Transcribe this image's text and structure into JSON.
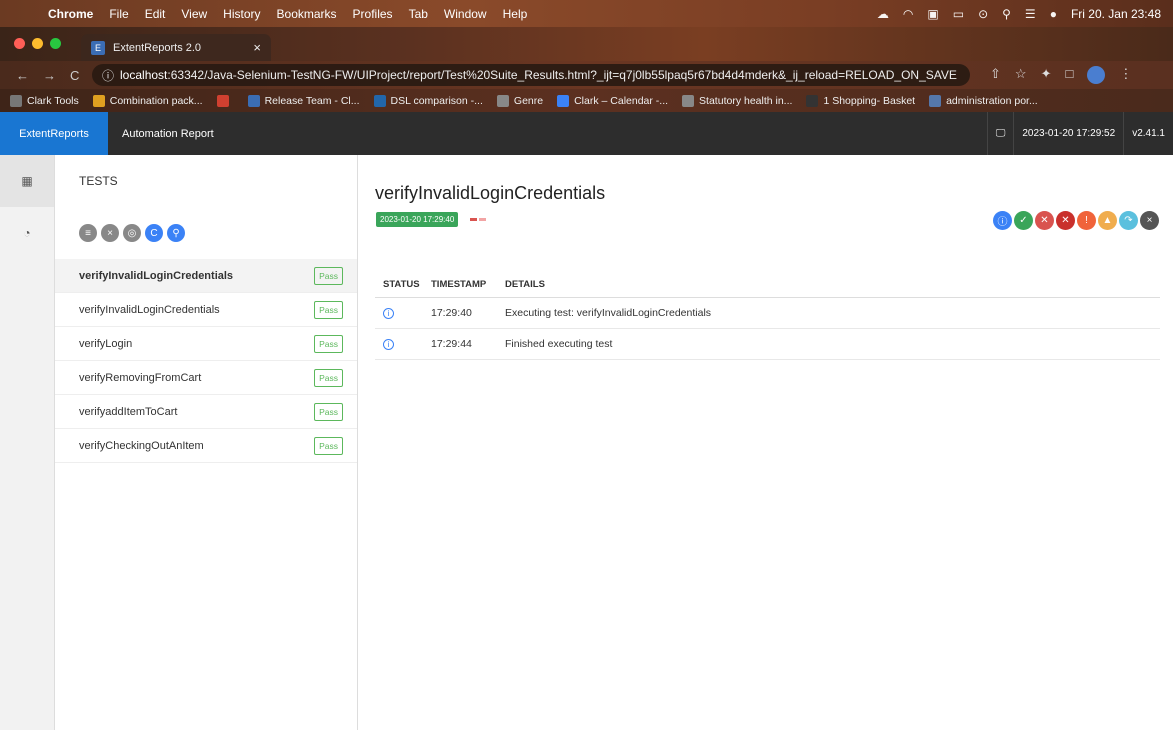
{
  "menubar": {
    "app": "Chrome",
    "items": [
      "File",
      "Edit",
      "View",
      "History",
      "Bookmarks",
      "Profiles",
      "Tab",
      "Window",
      "Help"
    ],
    "datetime": "Fri 20. Jan 23:48"
  },
  "browser": {
    "tab_title": "ExtentReports 2.0",
    "url_prefix": "localhost",
    "url_rest": ":63342/Java-Selenium-TestNG-FW/UIProject/report/Test%20Suite_Results.html?_ijt=q7j0lb55lpaq5r67bd4d4mderk&_ij_reload=RELOAD_ON_SAVE",
    "bookmarks": [
      {
        "label": "Clark Tools",
        "color": "#777777"
      },
      {
        "label": "Combination pack...",
        "color": "#e0a020"
      },
      {
        "label": "",
        "color": "#d04030"
      },
      {
        "label": "Release Team - Cl...",
        "color": "#3b6db4"
      },
      {
        "label": "DSL comparison -...",
        "color": "#2266aa"
      },
      {
        "label": "Genre",
        "color": "#888888"
      },
      {
        "label": "Clark – Calendar -...",
        "color": "#3b82f6"
      },
      {
        "label": "Statutory health in...",
        "color": "#888888"
      },
      {
        "label": "1 Shopping- Basket",
        "color": "#333333"
      },
      {
        "label": "administration por...",
        "color": "#5577aa"
      }
    ]
  },
  "report": {
    "brand": "ExtentReports",
    "title": "Automation Report",
    "run_datetime": "2023-01-20 17:29:52",
    "version": "v2.41.1",
    "tests_header": "TESTS",
    "tests": [
      {
        "name": "verifyInvalidLoginCredentials",
        "status": "Pass"
      },
      {
        "name": "verifyInvalidLoginCredentials",
        "status": "Pass"
      },
      {
        "name": "verifyLogin",
        "status": "Pass"
      },
      {
        "name": "verifyRemovingFromCart",
        "status": "Pass"
      },
      {
        "name": "verifyaddItemToCart",
        "status": "Pass"
      },
      {
        "name": "verifyCheckingOutAnItem",
        "status": "Pass"
      }
    ],
    "selected": {
      "name": "verifyInvalidLoginCredentials",
      "timestamp": "2023-01-20 17:29:40",
      "columns": [
        "STATUS",
        "TIMESTAMP",
        "DETAILS"
      ],
      "logs": [
        {
          "time": "17:29:40",
          "details": "Executing test: verifyInvalidLoginCredentials"
        },
        {
          "time": "17:29:44",
          "details": "Finished executing test"
        }
      ]
    },
    "status_filter_colors": [
      "#3b82f6",
      "#3aa55a",
      "#d9534f",
      "#c9302c",
      "#f0633a",
      "#f0ad4e",
      "#5bc0de",
      "#555555"
    ]
  }
}
